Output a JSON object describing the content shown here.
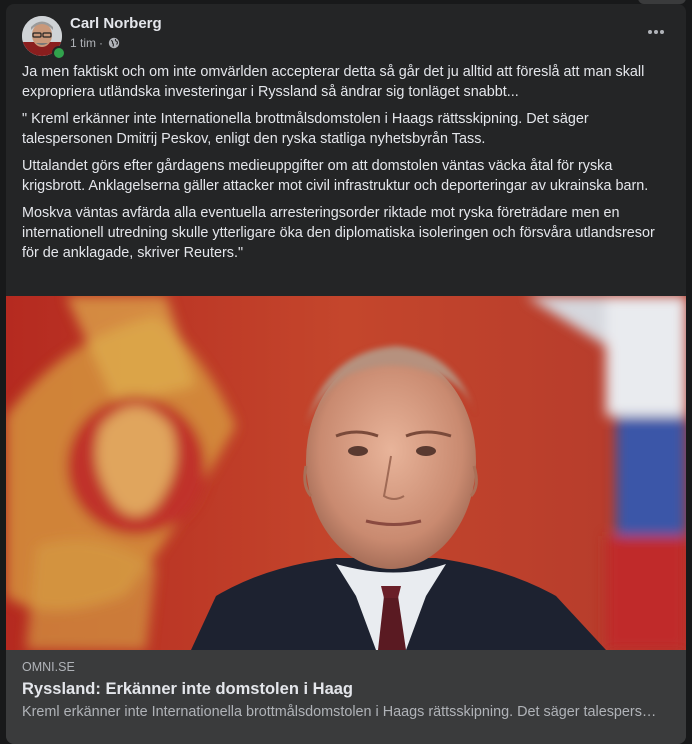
{
  "post": {
    "author": "Carl Norberg",
    "time": "1 tim",
    "separator": "·",
    "visibility_icon": "globe-icon",
    "more_icon": "more-horizontal-icon",
    "paragraphs": [
      "Ja men faktiskt och om inte omvärlden accepterar detta så går det ju alltid att föreslå att man skall expropriera utländska investeringar i Ryssland så ändrar sig tonläget snabbt...",
      "\" Kreml erkänner inte Internationella brottmålsdomstolen i Haags rättsskipning. Det säger talespersonen Dmitrij Peskov, enligt den ryska statliga nyhetsbyrån Tass.",
      "Uttalandet görs efter gårdagens medieuppgifter om att domstolen väntas väcka åtal för ryska krigsbrott. Anklagelserna gäller attacker mot civil infrastruktur och deporteringar av ukrainska barn.",
      "Moskva väntas avfärda alla eventuella arresteringsorder riktade mot ryska företrädare men en internationell utredning skulle ytterligare öka den diplomatiska isoleringen och försvåra utlandsresor för de anklagade, skriver Reuters.\""
    ]
  },
  "link_preview": {
    "domain": "OMNI.SE",
    "title": "Ryssland: Erkänner inte domstolen i Haag",
    "description": "Kreml erkänner inte Internationella brottmålsdomstolen i Haags rättsskipning. Det säger talespersonen Dmitrij Peskov, enligt den ryska statliga nyhetsbyrån Tass."
  },
  "colors": {
    "background": "#18191a",
    "card": "#242526",
    "link_footer": "#3a3b3c",
    "text_primary": "#e4e6eb",
    "text_secondary": "#b0b3b8",
    "online": "#31a24c"
  }
}
